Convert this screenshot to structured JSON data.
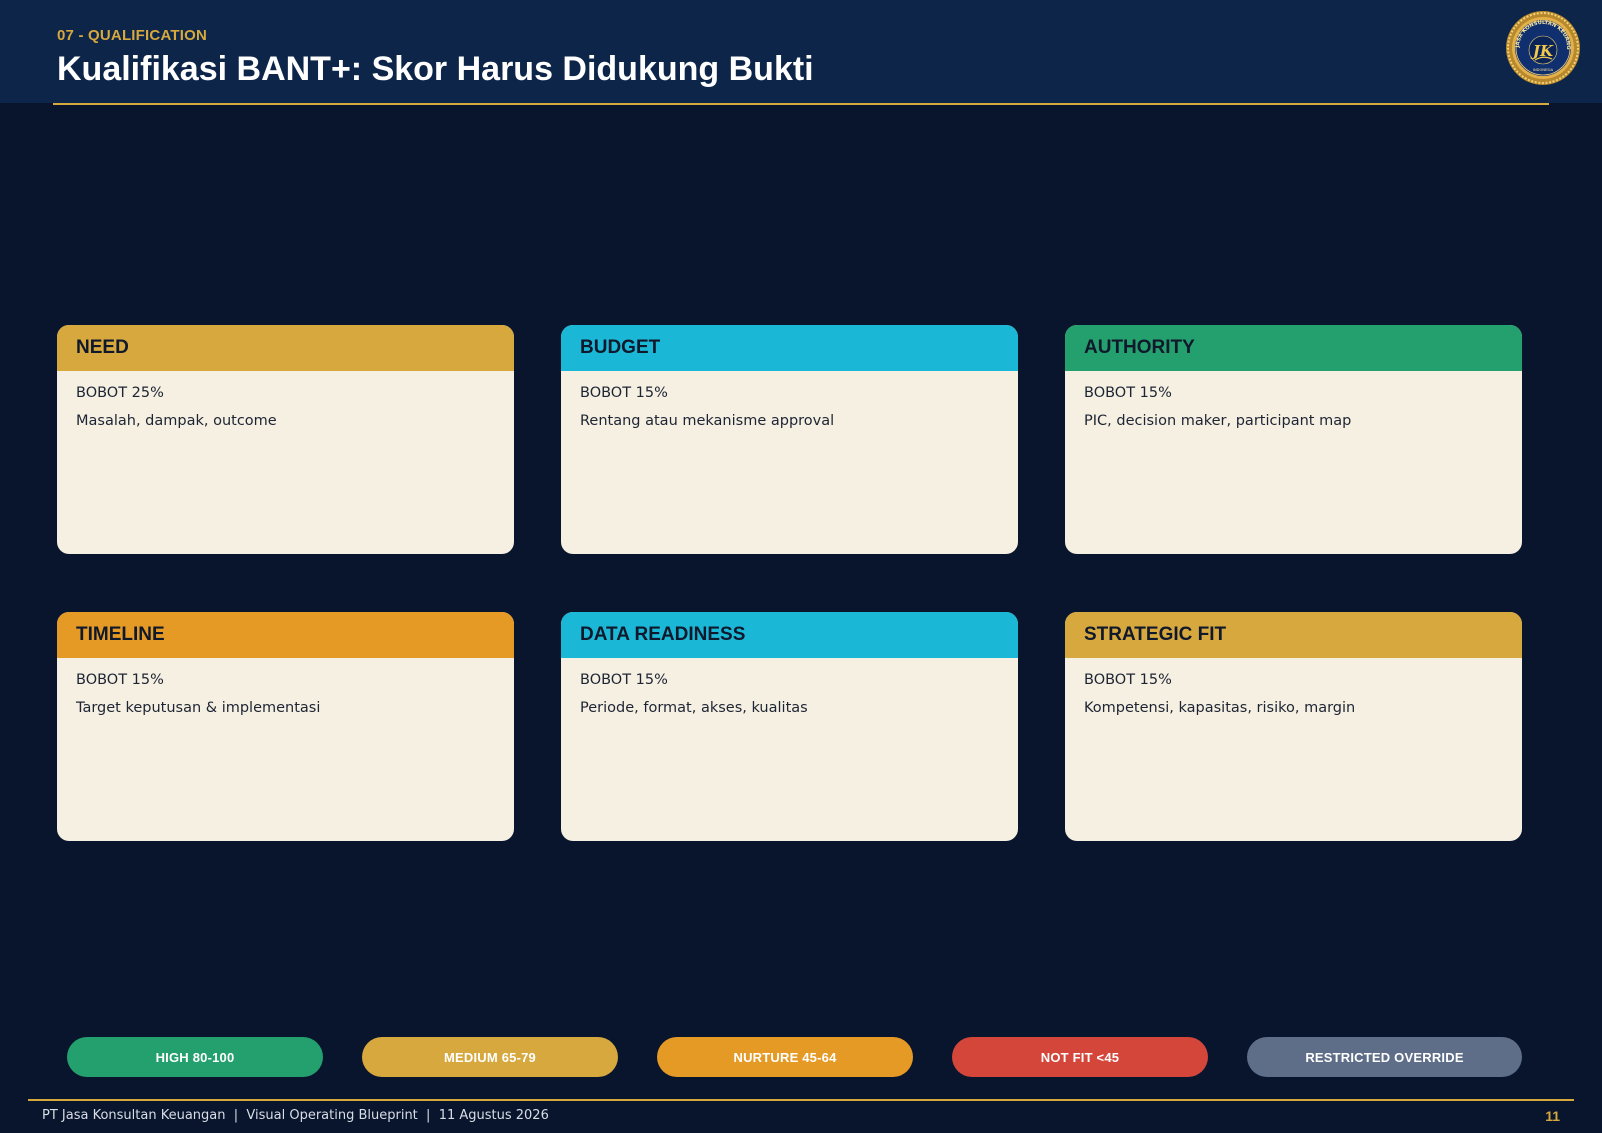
{
  "header": {
    "section_tag": "07 - QUALIFICATION",
    "title": "Kualifikasi BANT+: Skor Harus Didukung Bukti"
  },
  "colors": {
    "gold": "#d6a83e",
    "cyan": "#1ab8d6",
    "green": "#24a06e",
    "orange": "#e69a26",
    "red": "#d4463a",
    "slate": "#5e6e88",
    "navy": "#08152c"
  },
  "cards": [
    {
      "title": "NEED",
      "weight": "BOBOT 25%",
      "desc": "Masalah, dampak, outcome"
    },
    {
      "title": "BUDGET",
      "weight": "BOBOT 15%",
      "desc": "Rentang atau mekanisme approval"
    },
    {
      "title": "AUTHORITY",
      "weight": "BOBOT 15%",
      "desc": "PIC, decision maker, participant map"
    },
    {
      "title": "TIMELINE",
      "weight": "BOBOT 15%",
      "desc": "Target keputusan & implementasi"
    },
    {
      "title": "DATA READINESS",
      "weight": "BOBOT 15%",
      "desc": "Periode, format, akses, kualitas"
    },
    {
      "title": "STRATEGIC FIT",
      "weight": "BOBOT 15%",
      "desc": "Kompetensi, kapasitas, risiko, margin"
    }
  ],
  "score_bands": [
    {
      "label": "HIGH 80-100"
    },
    {
      "label": "MEDIUM 65-79"
    },
    {
      "label": "NURTURE 45-64"
    },
    {
      "label": "NOT FIT <45"
    },
    {
      "label": "RESTRICTED OVERRIDE"
    }
  ],
  "footer": {
    "text": "PT Jasa Konsultan Keuangan  |  Visual Operating Blueprint  |  11 Agustus 2026",
    "page_number": "11"
  },
  "logo": {
    "icon": "company-seal-logo",
    "arc_text": "PT. JASA KONSULTAN KEUANGAN",
    "bottom_text": "INDONESIA",
    "monogram": "JK"
  }
}
